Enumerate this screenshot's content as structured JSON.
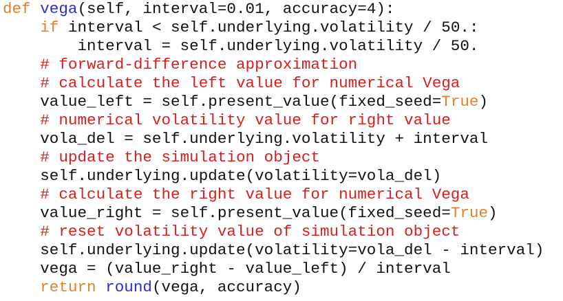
{
  "colors": {
    "keyword": "#e0812a",
    "function": "#2b2be0",
    "comment": "#d81e1e",
    "text": "#111111",
    "background": "#ffffff"
  },
  "code": {
    "lines": [
      {
        "tokens": [
          {
            "t": "def",
            "c": "kw"
          },
          {
            "t": " ",
            "c": "tx"
          },
          {
            "t": "vega",
            "c": "fn"
          },
          {
            "t": "(self, interval=0.01, accuracy=4):",
            "c": "tx"
          }
        ]
      },
      {
        "tokens": [
          {
            "t": "    ",
            "c": "tx"
          },
          {
            "t": "if",
            "c": "kw"
          },
          {
            "t": " interval < self.underlying.volatility / 50.:",
            "c": "tx"
          }
        ]
      },
      {
        "tokens": [
          {
            "t": "        interval = self.underlying.volatility / 50.",
            "c": "tx"
          }
        ]
      },
      {
        "tokens": [
          {
            "t": "    ",
            "c": "tx"
          },
          {
            "t": "# forward-difference approximation",
            "c": "cm"
          }
        ]
      },
      {
        "tokens": [
          {
            "t": "    ",
            "c": "tx"
          },
          {
            "t": "# calculate the left value for numerical Vega",
            "c": "cm"
          }
        ]
      },
      {
        "tokens": [
          {
            "t": "    value_left = self.present_value(fixed_seed=",
            "c": "tx"
          },
          {
            "t": "True",
            "c": "kw"
          },
          {
            "t": ")",
            "c": "tx"
          }
        ]
      },
      {
        "tokens": [
          {
            "t": "    ",
            "c": "tx"
          },
          {
            "t": "# numerical volatility value for right value",
            "c": "cm"
          }
        ]
      },
      {
        "tokens": [
          {
            "t": "    vola_del = self.underlying.volatility + interval",
            "c": "tx"
          }
        ]
      },
      {
        "tokens": [
          {
            "t": "    ",
            "c": "tx"
          },
          {
            "t": "# update the simulation object",
            "c": "cm"
          }
        ]
      },
      {
        "tokens": [
          {
            "t": "    self.underlying.update(volatility=vola_del)",
            "c": "tx"
          }
        ]
      },
      {
        "tokens": [
          {
            "t": "    ",
            "c": "tx"
          },
          {
            "t": "# calculate the right value for numerical Vega",
            "c": "cm"
          }
        ]
      },
      {
        "tokens": [
          {
            "t": "    value_right = self.present_value(fixed_seed=",
            "c": "tx"
          },
          {
            "t": "True",
            "c": "kw"
          },
          {
            "t": ")",
            "c": "tx"
          }
        ]
      },
      {
        "tokens": [
          {
            "t": "    ",
            "c": "tx"
          },
          {
            "t": "# reset volatility value of simulation object",
            "c": "cm"
          }
        ]
      },
      {
        "tokens": [
          {
            "t": "    self.underlying.update(volatility=vola_del - interval)",
            "c": "tx"
          }
        ]
      },
      {
        "tokens": [
          {
            "t": "    vega = (value_right - value_left) / interval",
            "c": "tx"
          }
        ]
      },
      {
        "tokens": [
          {
            "t": "    ",
            "c": "tx"
          },
          {
            "t": "return",
            "c": "kw"
          },
          {
            "t": " ",
            "c": "tx"
          },
          {
            "t": "round",
            "c": "fn"
          },
          {
            "t": "(vega, accuracy)",
            "c": "tx"
          }
        ]
      }
    ]
  }
}
